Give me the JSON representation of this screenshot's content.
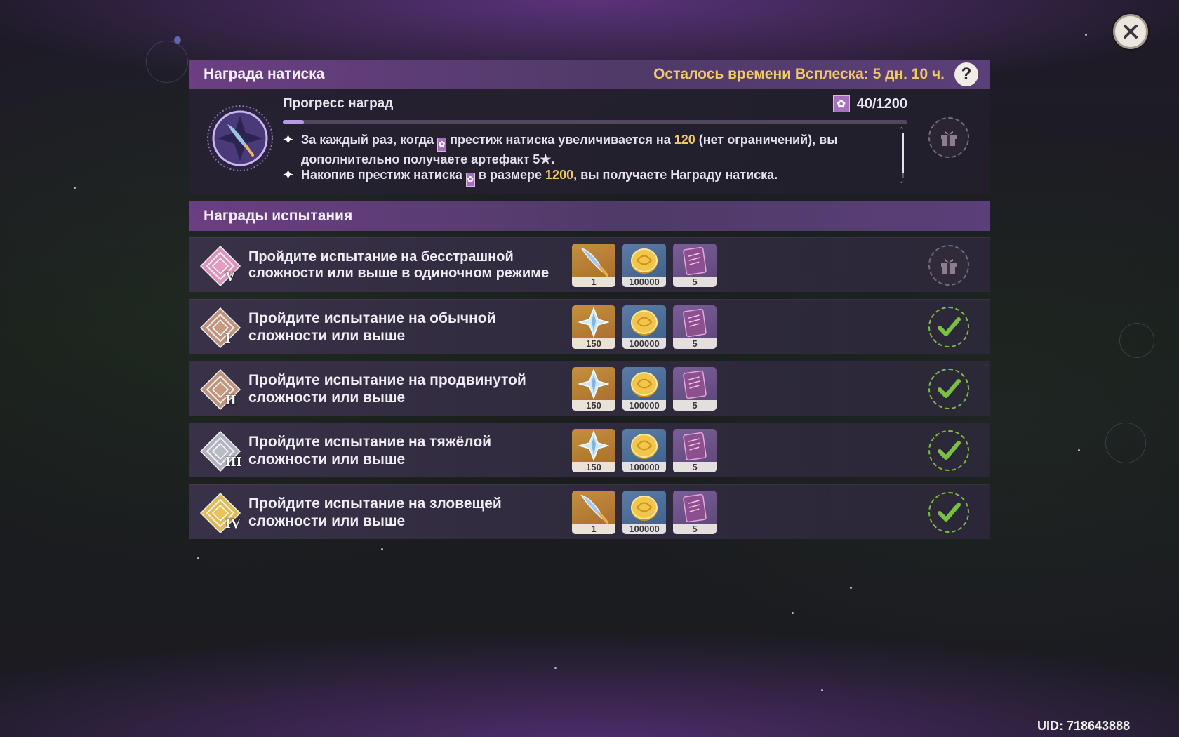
{
  "close_icon": "close-icon",
  "surge": {
    "title": "Награда натиска",
    "time_left": "Осталось времени Всплеска: 5 дн. 10 ч.",
    "help_label": "?",
    "progress_title": "Прогресс наград",
    "progress_count": "40/1200",
    "progress_fraction": 0.0333,
    "rule_1_a": "За каждый раз, когда",
    "rule_1_b": "престиж натиска увеличивается на",
    "rule_1_num": "120",
    "rule_1_c": "(нет ограничений), вы дополнительно получаете артефакт 5★.",
    "rule_2_a": "Накопив престиж натиска",
    "rule_2_b": "в размере",
    "rule_2_num": "1200",
    "rule_2_c": ", вы получаете Награду натиска."
  },
  "challenges": {
    "title": "Награды испытания",
    "rows": [
      {
        "badge_num": "V",
        "badge_color": "#e59bc0",
        "desc": "Пройдите испытание на бесстрашной сложности или выше в одиночном режиме",
        "items": [
          {
            "kind": "feather",
            "qty": "1"
          },
          {
            "kind": "mora",
            "qty": "100000"
          },
          {
            "kind": "book",
            "qty": "5"
          }
        ],
        "status": "unclaimed"
      },
      {
        "badge_num": "I",
        "badge_color": "#c79a82",
        "desc": "Пройдите испытание на обычной сложности или выше",
        "items": [
          {
            "kind": "primogem",
            "qty": "150"
          },
          {
            "kind": "mora",
            "qty": "100000"
          },
          {
            "kind": "book",
            "qty": "5"
          }
        ],
        "status": "claimed"
      },
      {
        "badge_num": "II",
        "badge_color": "#c79a82",
        "desc": "Пройдите испытание на продвинутой сложности или выше",
        "items": [
          {
            "kind": "primogem",
            "qty": "150"
          },
          {
            "kind": "mora",
            "qty": "100000"
          },
          {
            "kind": "book",
            "qty": "5"
          }
        ],
        "status": "claimed"
      },
      {
        "badge_num": "III",
        "badge_color": "#b8bcc6",
        "desc": "Пройдите испытание на тяжёлой сложности или выше",
        "items": [
          {
            "kind": "primogem",
            "qty": "150"
          },
          {
            "kind": "mora",
            "qty": "100000"
          },
          {
            "kind": "book",
            "qty": "5"
          }
        ],
        "status": "claimed"
      },
      {
        "badge_num": "IV",
        "badge_color": "#e8c35a",
        "desc": "Пройдите испытание на зловещей сложности или выше",
        "items": [
          {
            "kind": "feather",
            "qty": "1"
          },
          {
            "kind": "mora",
            "qty": "100000"
          },
          {
            "kind": "book",
            "qty": "5"
          }
        ],
        "status": "claimed"
      }
    ]
  },
  "uid": "UID: 718643888",
  "colors": {
    "accent_gold": "#f2c766",
    "check_green": "#7ac043",
    "header_purple": "#6b3f82"
  }
}
